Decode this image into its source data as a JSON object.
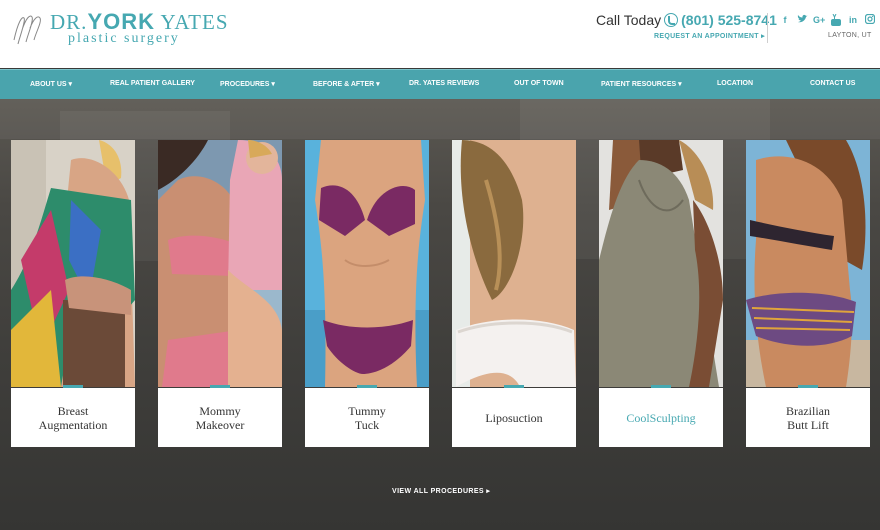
{
  "header": {
    "logo": {
      "initials": "yyy",
      "prefix": "DR.",
      "first": "YORK",
      "last": "YATES",
      "subtitle": "plastic surgery"
    },
    "call_label": "Call Today",
    "phone": "(801) 525-8741",
    "request_link": "REQUEST AN APPOINTMENT ▸",
    "social": [
      "facebook-icon",
      "twitter-icon",
      "google-plus-icon",
      "youtube-icon",
      "linkedin-icon",
      "instagram-icon"
    ],
    "location": "LAYTON, UT"
  },
  "nav": {
    "items": [
      {
        "label": "ABOUT US ▾"
      },
      {
        "label": "REAL PATIENT GALLERY"
      },
      {
        "label": "PROCEDURES ▾"
      },
      {
        "label": "BEFORE & AFTER ▾"
      },
      {
        "label": "DR. YATES REVIEWS"
      },
      {
        "label": "OUT OF TOWN"
      },
      {
        "label": "PATIENT RESOURCES ▾"
      },
      {
        "label": "LOCATION"
      },
      {
        "label": "CONTACT US"
      }
    ]
  },
  "procedures": [
    {
      "label": "Breast\nAugmentation",
      "highlighted": false
    },
    {
      "label": "Mommy\nMakeover",
      "highlighted": false
    },
    {
      "label": "Tummy\nTuck",
      "highlighted": false
    },
    {
      "label": "Liposuction",
      "highlighted": false
    },
    {
      "label": "CoolSculpting",
      "highlighted": true
    },
    {
      "label": "Brazilian\nButt Lift",
      "highlighted": false
    }
  ],
  "view_all": "VIEW ALL PROCEDURES ▸",
  "colors": {
    "accent": "#46a8b1",
    "nav": "#4aa4ad",
    "background": "#3f3e3b"
  }
}
